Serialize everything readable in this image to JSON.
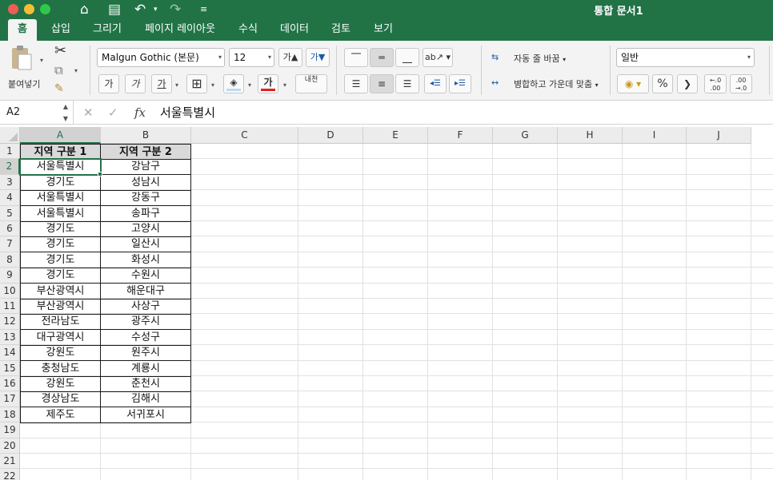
{
  "window": {
    "title": "통합 문서1"
  },
  "ribbon_tabs": [
    "홈",
    "삽입",
    "그리기",
    "페이지 레이아웃",
    "수식",
    "데이터",
    "검토",
    "보기"
  ],
  "active_tab": "홈",
  "ribbon": {
    "paste_label": "붙여넣기",
    "font_name": "Malgun Gothic (본문)",
    "font_size": "12",
    "increase_font": "가▲",
    "decrease_font": "가▼",
    "bold": "가",
    "italic": "가",
    "underline": "가",
    "font_color": "가",
    "phonetic": "내천",
    "wrap_text": "자동 줄 바꿈",
    "merge_center": "병합하고 가운데 맞춤",
    "number_format": "일반",
    "percent": "%",
    "comma": "❯",
    "dec_increase": "←.0 .00",
    "dec_decrease": ".00 →.0"
  },
  "formula_bar": {
    "name_box": "A2",
    "cancel": "✕",
    "enter": "✓",
    "fx": "fx",
    "content": "서울특별시"
  },
  "columns": [
    "A",
    "B",
    "C",
    "D",
    "E",
    "F",
    "G",
    "H",
    "I",
    "J"
  ],
  "row_numbers": [
    "1",
    "2",
    "3",
    "4",
    "5",
    "6",
    "7",
    "8",
    "9",
    "10",
    "11",
    "12",
    "13",
    "14",
    "15",
    "16",
    "17",
    "18",
    "19",
    "20",
    "21",
    "22"
  ],
  "table": {
    "headers": [
      "지역 구분 1",
      "지역 구분 2"
    ],
    "rows": [
      [
        "서울특별시",
        "강남구"
      ],
      [
        "경기도",
        "성남시"
      ],
      [
        "서울특별시",
        "강동구"
      ],
      [
        "서울특별시",
        "송파구"
      ],
      [
        "경기도",
        "고양시"
      ],
      [
        "경기도",
        "일산시"
      ],
      [
        "경기도",
        "화성시"
      ],
      [
        "경기도",
        "수원시"
      ],
      [
        "부산광역시",
        "해운대구"
      ],
      [
        "부산광역시",
        "사상구"
      ],
      [
        "전라남도",
        "광주시"
      ],
      [
        "대구광역시",
        "수성구"
      ],
      [
        "강원도",
        "원주시"
      ],
      [
        "충청남도",
        "계룡시"
      ],
      [
        "강원도",
        "춘천시"
      ],
      [
        "경상남도",
        "김해시"
      ],
      [
        "제주도",
        "서귀포시"
      ]
    ]
  },
  "active_cell": "A2",
  "colors": {
    "excel_green": "#217346",
    "header_fill": "#d9d9d9"
  }
}
